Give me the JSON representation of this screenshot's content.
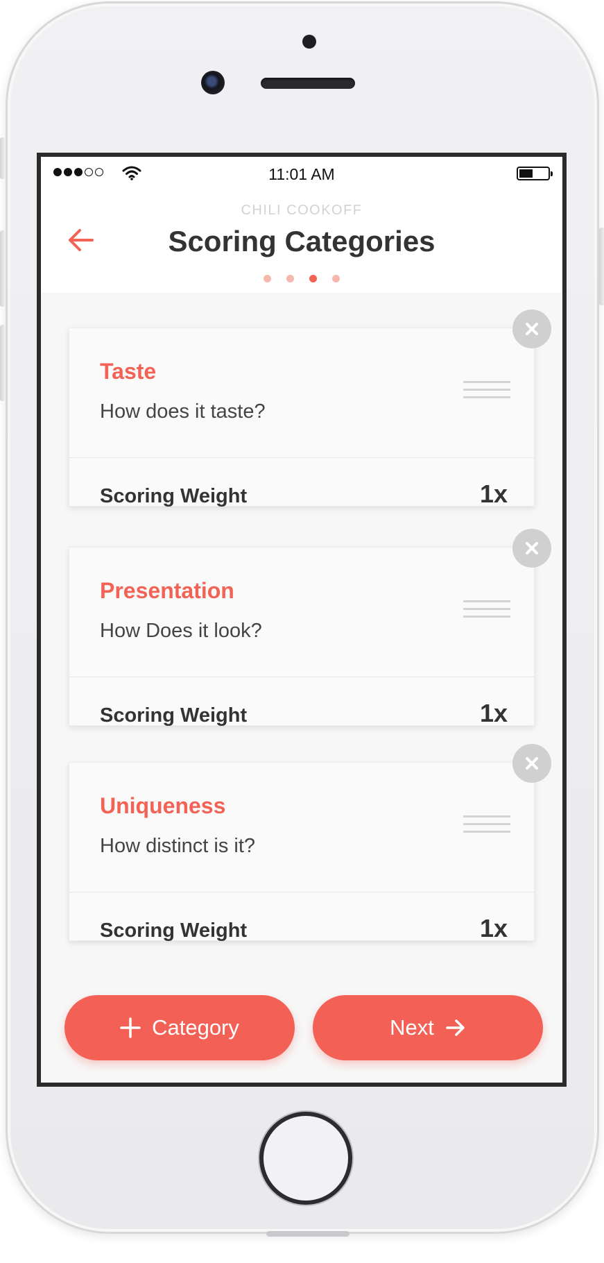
{
  "status_bar": {
    "time": "11:01 AM"
  },
  "header": {
    "overline": "CHILI COOKOFF",
    "title": "Scoring Categories",
    "steps": {
      "total": 4,
      "current": 3
    }
  },
  "categories": [
    {
      "name": "Taste",
      "question": "How does it taste?",
      "weight_label": "Scoring Weight",
      "weight": "1x"
    },
    {
      "name": "Presentation",
      "question": "How Does it look?",
      "weight_label": "Scoring Weight",
      "weight": "1x"
    },
    {
      "name": "Uniqueness",
      "question": "How distinct is it?",
      "weight_label": "Scoring Weight",
      "weight": "1x"
    }
  ],
  "actions": {
    "add_category_label": "Category",
    "next_label": "Next"
  },
  "colors": {
    "accent": "#f26355",
    "accent_light": "#f6b7ad",
    "text_dark": "#333333",
    "muted": "#d2d2d2"
  }
}
